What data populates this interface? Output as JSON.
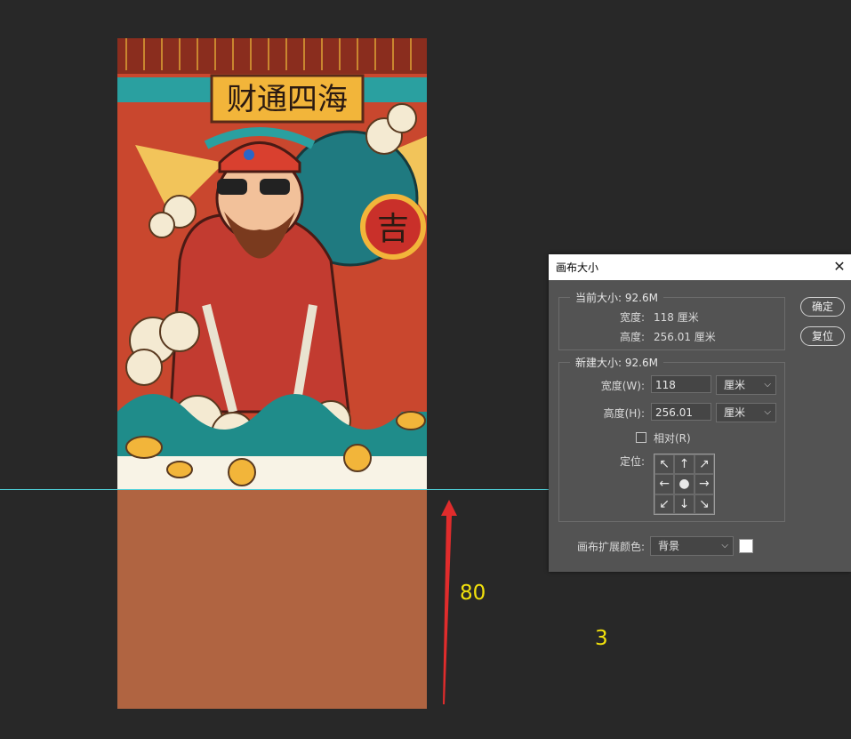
{
  "annotations": {
    "number_80": "80",
    "number_3": "3"
  },
  "artwork": {
    "plaque_text": "财通四海",
    "sack_char": "吉"
  },
  "dialog": {
    "title": "画布大小",
    "ok_label": "确定",
    "reset_label": "复位",
    "current": {
      "title": "当前大小: 92.6M",
      "width_label": "宽度:",
      "width_value": "118 厘米",
      "height_label": "高度:",
      "height_value": "256.01 厘米"
    },
    "new_size": {
      "title": "新建大小: 92.6M",
      "width_label": "宽度(W):",
      "width_value": "118",
      "width_unit": "厘米",
      "height_label": "高度(H):",
      "height_value": "256.01",
      "height_unit": "厘米",
      "relative_label": "相对(R)",
      "anchor_label": "定位:"
    },
    "extension_color_label": "画布扩展颜色:",
    "extension_color_value": "背景"
  },
  "colors": {
    "extension": "#b06441",
    "guide": "#4fd0d9",
    "annotation": "#f3e20c"
  }
}
